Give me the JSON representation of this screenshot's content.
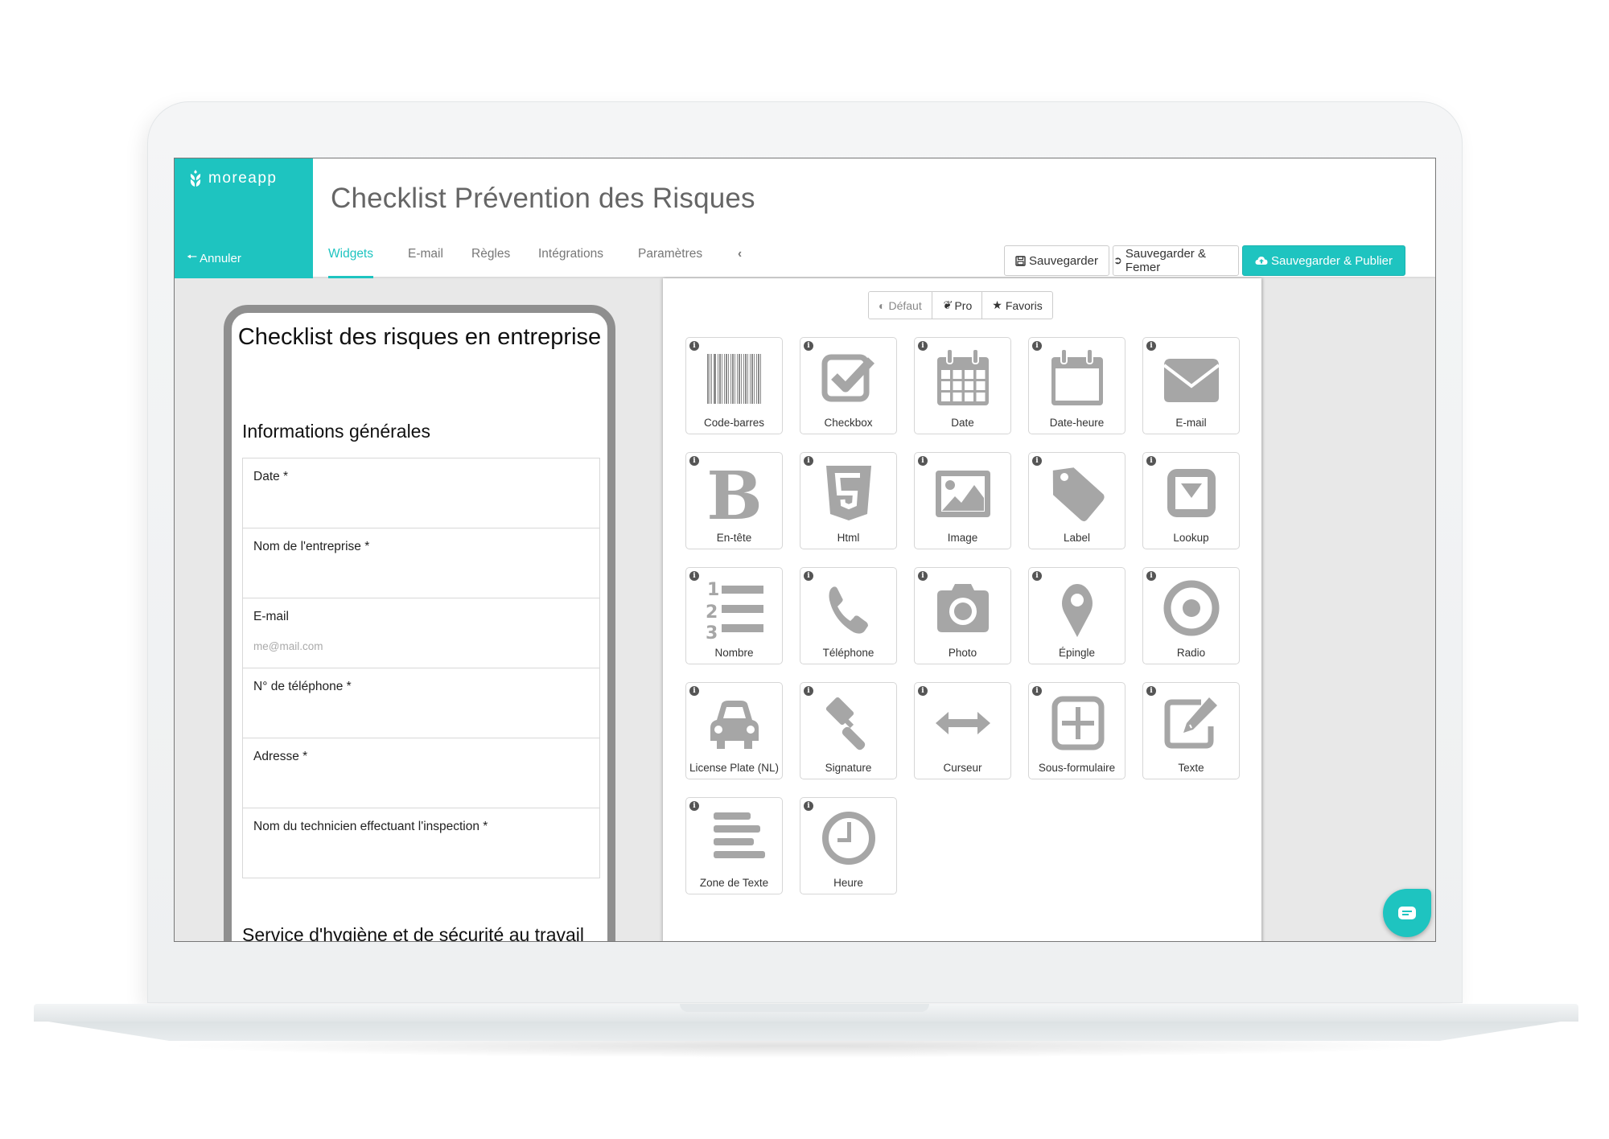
{
  "app": {
    "brand": "moreapp",
    "form_title": "Checklist Prévention des Risques",
    "cancel_label": "Annuler",
    "accent_color": "#1ec4c0"
  },
  "tabs": [
    {
      "label": "Widgets",
      "active": true
    },
    {
      "label": "E-mail",
      "active": false
    },
    {
      "label": "Règles",
      "active": false
    },
    {
      "label": "Intégrations",
      "active": false
    },
    {
      "label": "Paramètres",
      "active": false
    }
  ],
  "toolbar": {
    "save_label": "Sauvegarder",
    "save_close_label": "Sauvegarder & Femer",
    "save_publish_label": "Sauvegarder & Publier"
  },
  "preview": {
    "title": "Checklist des risques en entreprise",
    "section1": "Informations générales",
    "fields": [
      {
        "label": "Date *",
        "placeholder": ""
      },
      {
        "label": "Nom de l'entreprise *",
        "placeholder": ""
      },
      {
        "label": "E-mail",
        "placeholder": "me@mail.com"
      },
      {
        "label": "N° de téléphone *",
        "placeholder": ""
      },
      {
        "label": "Adresse *",
        "placeholder": ""
      },
      {
        "label": "Nom du technicien effectuant l'inspection *",
        "placeholder": ""
      }
    ],
    "section2": "Service d'hygiène et de sécurité au travail"
  },
  "widget_filters": [
    {
      "label": "Défaut",
      "icon": "dashboard-icon"
    },
    {
      "label": "Pro",
      "icon": "leaf-icon"
    },
    {
      "label": "Favoris",
      "icon": "star-icon"
    }
  ],
  "widgets": [
    {
      "label": "Code-barres",
      "icon": "barcode"
    },
    {
      "label": "Checkbox",
      "icon": "checkbox"
    },
    {
      "label": "Date",
      "icon": "calendar"
    },
    {
      "label": "Date-heure",
      "icon": "calendar-blank"
    },
    {
      "label": "E-mail",
      "icon": "envelope"
    },
    {
      "label": "En-tête",
      "icon": "bold"
    },
    {
      "label": "Html",
      "icon": "html5"
    },
    {
      "label": "Image",
      "icon": "image"
    },
    {
      "label": "Label",
      "icon": "tag"
    },
    {
      "label": "Lookup",
      "icon": "dropdown"
    },
    {
      "label": "Nombre",
      "icon": "numbered-list"
    },
    {
      "label": "Téléphone",
      "icon": "phone"
    },
    {
      "label": "Photo",
      "icon": "camera"
    },
    {
      "label": "Épingle",
      "icon": "map-pin"
    },
    {
      "label": "Radio",
      "icon": "radio"
    },
    {
      "label": "License Plate (NL)",
      "icon": "car"
    },
    {
      "label": "Signature",
      "icon": "gavel"
    },
    {
      "label": "Curseur",
      "icon": "arrows-h"
    },
    {
      "label": "Sous-formulaire",
      "icon": "plus-square"
    },
    {
      "label": "Texte",
      "icon": "edit"
    },
    {
      "label": "Zone de Texte",
      "icon": "text-lines"
    },
    {
      "label": "Heure",
      "icon": "clock"
    }
  ]
}
